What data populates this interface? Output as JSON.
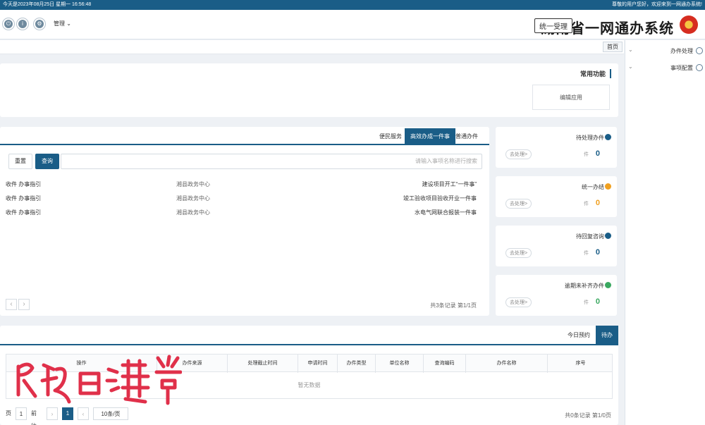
{
  "topstrip": {
    "left": "今天是2023年08月25日 星期一 16:56:48",
    "right": "尊敬的用户您好，欢迎来到一网通办系统!"
  },
  "header": {
    "title": "湖南省一网通办系统",
    "tag": "统一受理",
    "user": "管理",
    "user_caret": "⌄",
    "icons": [
      "power-icon",
      "info-icon",
      "settings-icon",
      "user-icon"
    ]
  },
  "breadcrumb": {
    "tab": "首页"
  },
  "sidebar": {
    "items": [
      {
        "label": "办件处理",
        "chevron": "⌄"
      },
      {
        "label": "事项配置",
        "chevron": "⌄"
      }
    ]
  },
  "common": {
    "title": "常用功能",
    "edit_label": "编辑应用"
  },
  "cards": [
    {
      "title": "待处理办件",
      "num": "0",
      "unit": "件",
      "go": "去处理>",
      "color": "#1a5d87"
    },
    {
      "title": "统一办结",
      "num": "0",
      "unit": "件",
      "go": "去处理>",
      "color": "#f0a020"
    },
    {
      "title": "待回复咨询",
      "num": "0",
      "unit": "件",
      "go": "去处理>",
      "color": "#1a5d87"
    },
    {
      "title": "逾期未补齐办件",
      "num": "0",
      "unit": "件",
      "go": "去处理>",
      "color": "#3aa860"
    }
  ],
  "services": {
    "tabs": [
      "普通办件",
      "高效办成一件事",
      "便民服务"
    ],
    "active_tab": 1,
    "search_placeholder": "请输入事项名称进行搜索",
    "query_label": "查询",
    "reset_label": "重置",
    "rows": [
      {
        "name": "建设项目开工“一件事”",
        "org": "湘县政务中心",
        "actions": "收件  办事指引"
      },
      {
        "name": "竣工验收项目验收开业一件事",
        "org": "湘县政务中心",
        "actions": "收件  办事指引"
      },
      {
        "name": "水电气网联合报装一件事",
        "org": "湘县政务中心",
        "actions": "收件  办事指引"
      }
    ],
    "page_info": "共3条记录 第1/1页",
    "prev": "‹",
    "next": "›"
  },
  "todo": {
    "tab_active": "待办",
    "tab_other": "今日预约",
    "columns": [
      "序号",
      "办件名称",
      "查询编码",
      "单位名称",
      "办件类型",
      "申请时间",
      "处理截止时间",
      "办件来源",
      "操作"
    ],
    "empty_text": "暂无数据",
    "page_info": "共0条记录 第1/0页",
    "page_size": "10条/页",
    "current_page": "1",
    "goto_label": "前往",
    "goto_value": "1",
    "page_suffix": "页",
    "prev": "‹",
    "next": "›"
  }
}
